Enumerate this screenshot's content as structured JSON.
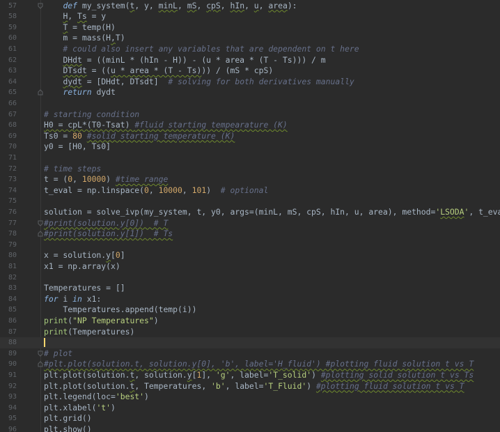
{
  "editor": {
    "colors": {
      "background": "#2b2b2b",
      "current_line": "#323232",
      "line_number": "#5f6368",
      "default": "#a9b7c6",
      "keyword": "#8bb3e0",
      "string": "#b8d07f",
      "number": "#d4a96a",
      "comment": "#67708a",
      "builtin": "#a5c87c",
      "squiggle": "#6f8a2d",
      "cursor": "#f5d76e"
    },
    "current_line": 88,
    "lines": [
      {
        "n": "57",
        "fold": "down",
        "tokens": [
          [
            "    ",
            ""
          ],
          [
            "def",
            "kw"
          ],
          [
            " my_system(",
            ""
          ],
          [
            "t",
            "",
            "sq"
          ],
          [
            ", y, ",
            ""
          ],
          [
            "minL",
            "",
            "sq"
          ],
          [
            ", ",
            ""
          ],
          [
            "mS",
            "",
            "sq"
          ],
          [
            ", ",
            ""
          ],
          [
            "cpS",
            "",
            "sq"
          ],
          [
            ", ",
            ""
          ],
          [
            "hIn",
            "",
            "sq"
          ],
          [
            ", ",
            ""
          ],
          [
            "u",
            "",
            "sq"
          ],
          [
            ", ",
            ""
          ],
          [
            "area",
            "",
            "sq"
          ],
          [
            "):",
            ""
          ]
        ]
      },
      {
        "n": "58",
        "tokens": [
          [
            "    ",
            ""
          ],
          [
            "H",
            "",
            "sq"
          ],
          [
            ", ",
            ""
          ],
          [
            "Ts",
            "",
            "sq"
          ],
          [
            " = y",
            ""
          ]
        ]
      },
      {
        "n": "59",
        "tokens": [
          [
            "    ",
            ""
          ],
          [
            "T",
            "",
            "sq"
          ],
          [
            " = temp(H)",
            ""
          ]
        ]
      },
      {
        "n": "60",
        "tokens": [
          [
            "    m = mass(H",
            ""
          ],
          [
            ",",
            "",
            "sq"
          ],
          [
            "T)",
            ""
          ]
        ]
      },
      {
        "n": "61",
        "tokens": [
          [
            "    # could also insert any variables that are dependent on t here",
            "cm"
          ]
        ]
      },
      {
        "n": "62",
        "tokens": [
          [
            "    ",
            ""
          ],
          [
            "DHdt",
            "",
            "sq"
          ],
          [
            " = ((minL * (hIn - H)) - (u * area * (T - Ts))) / m",
            ""
          ]
        ]
      },
      {
        "n": "63",
        "tokens": [
          [
            "    ",
            ""
          ],
          [
            "DTsdt",
            "",
            "sq"
          ],
          [
            " = ((",
            ""
          ],
          [
            "u * area * (T - Ts)",
            "",
            "sq"
          ],
          [
            ")) / (mS * cpS)",
            ""
          ]
        ]
      },
      {
        "n": "64",
        "tokens": [
          [
            "    ",
            ""
          ],
          [
            "dydt",
            "",
            "sq"
          ],
          [
            " = [DHdt, DTsdt]  ",
            ""
          ],
          [
            "# solving for both derivatives manually",
            "cm"
          ]
        ]
      },
      {
        "n": "65",
        "fold": "up",
        "tokens": [
          [
            "    ",
            ""
          ],
          [
            "return",
            "kw"
          ],
          [
            " dydt",
            ""
          ]
        ]
      },
      {
        "n": "66",
        "tokens": []
      },
      {
        "n": "67",
        "tokens": [
          [
            "# starting condition",
            "cm"
          ]
        ]
      },
      {
        "n": "68",
        "tokens": [
          [
            "H0 = cpL*(T0-Tsat) ",
            "",
            "sq"
          ],
          [
            "#fluid starting tempearature (K)",
            "cm",
            "sq"
          ]
        ]
      },
      {
        "n": "69",
        "tokens": [
          [
            "Ts0 = ",
            ""
          ],
          [
            "80",
            "num"
          ],
          [
            " ",
            ""
          ],
          [
            "#solid starting temperature (K)",
            "cm",
            "sq"
          ]
        ]
      },
      {
        "n": "70",
        "tokens": [
          [
            "y0 = [H0, Ts0]",
            ""
          ]
        ]
      },
      {
        "n": "71",
        "tokens": []
      },
      {
        "n": "72",
        "tokens": [
          [
            "# time steps",
            "cm"
          ]
        ]
      },
      {
        "n": "73",
        "tokens": [
          [
            "t = (",
            ""
          ],
          [
            "0",
            "num"
          ],
          [
            ", ",
            ""
          ],
          [
            "10000",
            "num"
          ],
          [
            ") ",
            ""
          ],
          [
            "#time range",
            "cm",
            "sq"
          ]
        ]
      },
      {
        "n": "74",
        "tokens": [
          [
            "t_eval = np.linspace(",
            ""
          ],
          [
            "0",
            "num"
          ],
          [
            ", ",
            ""
          ],
          [
            "10000",
            "num"
          ],
          [
            ", ",
            ""
          ],
          [
            "101",
            "num"
          ],
          [
            ")  ",
            ""
          ],
          [
            "# optional",
            "cm"
          ]
        ]
      },
      {
        "n": "75",
        "tokens": []
      },
      {
        "n": "76",
        "tokens": [
          [
            "solution = solve_ivp(my_system, t, y0, args=(minL, mS, cpS, hIn, u, area), method=",
            ""
          ],
          [
            "'",
            "str"
          ],
          [
            "LSODA",
            "str",
            "sq"
          ],
          [
            "'",
            "str"
          ],
          [
            ", t_eval=t_eval)",
            ""
          ]
        ]
      },
      {
        "n": "77",
        "fold": "down",
        "tokens": [
          [
            "#print(solution.y[0])  # T",
            "cm",
            "sq"
          ]
        ]
      },
      {
        "n": "78",
        "fold": "up",
        "tokens": [
          [
            "#print(solution.y[1])  # Ts",
            "cm",
            "sq"
          ]
        ]
      },
      {
        "n": "79",
        "tokens": []
      },
      {
        "n": "80",
        "tokens": [
          [
            "x = solution.",
            ""
          ],
          [
            "y",
            "",
            "sq"
          ],
          [
            "[",
            ""
          ],
          [
            "0",
            "num"
          ],
          [
            "]",
            ""
          ]
        ]
      },
      {
        "n": "81",
        "tokens": [
          [
            "x1 = np.array(x)",
            ""
          ]
        ]
      },
      {
        "n": "82",
        "tokens": []
      },
      {
        "n": "83",
        "tokens": [
          [
            "Temperatures = []",
            ""
          ]
        ]
      },
      {
        "n": "84",
        "tokens": [
          [
            "for",
            "kw"
          ],
          [
            " i ",
            ""
          ],
          [
            "in",
            "kw"
          ],
          [
            " x1:",
            ""
          ]
        ]
      },
      {
        "n": "85",
        "tokens": [
          [
            "    Temperatures.append(temp(i))",
            ""
          ]
        ]
      },
      {
        "n": "86",
        "tokens": [
          [
            "print",
            "bi"
          ],
          [
            "(",
            ""
          ],
          [
            "\"NP Temperatures\"",
            "str"
          ],
          [
            ")",
            ""
          ]
        ]
      },
      {
        "n": "87",
        "tokens": [
          [
            "print",
            "bi"
          ],
          [
            "(Temperatures)",
            ""
          ]
        ]
      },
      {
        "n": "88",
        "current": true,
        "tokens": []
      },
      {
        "n": "89",
        "fold": "down",
        "tokens": [
          [
            "# plot",
            "cm"
          ]
        ]
      },
      {
        "n": "90",
        "fold": "up",
        "tokens": [
          [
            "#plt.plot(solution.t, solution.y[0], 'b', label='H_fluid') #plotting fluid solution t vs T",
            "cm",
            "sq"
          ]
        ]
      },
      {
        "n": "91",
        "tokens": [
          [
            "plt.plot(solution.",
            ""
          ],
          [
            "t",
            "",
            "sq"
          ],
          [
            ", solution.",
            ""
          ],
          [
            "y",
            "",
            "sq"
          ],
          [
            "[",
            ""
          ],
          [
            "1",
            "num"
          ],
          [
            "], ",
            ""
          ],
          [
            "'g'",
            "str"
          ],
          [
            ", label=",
            ""
          ],
          [
            "'T_solid'",
            "str"
          ],
          [
            ") ",
            ""
          ],
          [
            "#plotting solid solution t vs Ts",
            "cm",
            "sq"
          ]
        ]
      },
      {
        "n": "92",
        "tokens": [
          [
            "plt.plot(solution.",
            ""
          ],
          [
            "t",
            "",
            "sq"
          ],
          [
            ", Temperatures, ",
            ""
          ],
          [
            "'b'",
            "str"
          ],
          [
            ", label=",
            ""
          ],
          [
            "'T_Fluid'",
            "str"
          ],
          [
            ") ",
            ""
          ],
          [
            "#plotting fluid solution t vs T",
            "cm",
            "sq"
          ]
        ]
      },
      {
        "n": "93",
        "tokens": [
          [
            "plt.legend(loc=",
            ""
          ],
          [
            "'best'",
            "str"
          ],
          [
            ")",
            ""
          ]
        ]
      },
      {
        "n": "94",
        "tokens": [
          [
            "plt.xlabel(",
            ""
          ],
          [
            "'t'",
            "str"
          ],
          [
            ")",
            ""
          ]
        ]
      },
      {
        "n": "95",
        "tokens": [
          [
            "plt.grid()",
            ""
          ]
        ]
      },
      {
        "n": "96",
        "tokens": [
          [
            "plt.show()",
            ""
          ]
        ]
      }
    ]
  }
}
